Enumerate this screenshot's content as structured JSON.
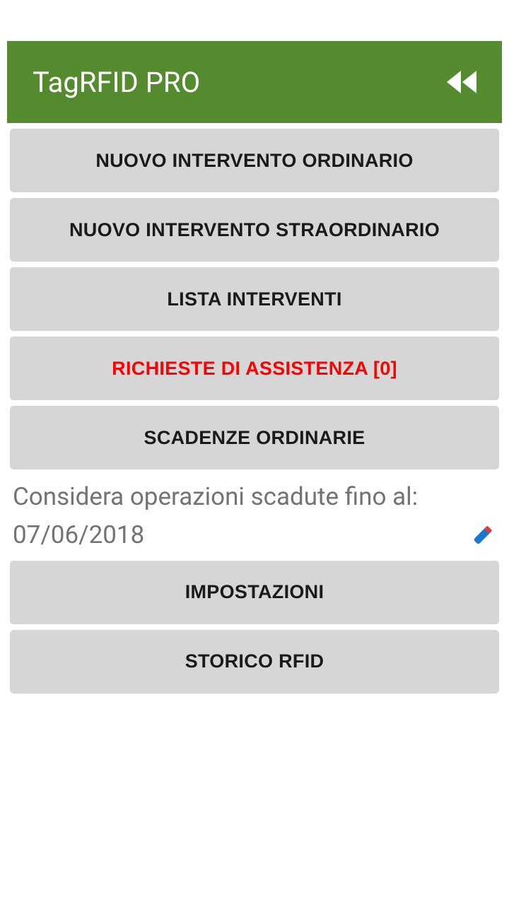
{
  "header": {
    "title": "TagRFID PRO"
  },
  "buttons": {
    "nuovo_ordinario": "NUOVO INTERVENTO ORDINARIO",
    "nuovo_straordinario": "NUOVO INTERVENTO STRAORDINARIO",
    "lista_interventi": "LISTA INTERVENTI",
    "richieste_assistenza": "RICHIESTE DI ASSISTENZA [0]",
    "scadenze_ordinarie": "SCADENZE ORDINARIE",
    "impostazioni": "IMPOSTAZIONI",
    "storico_rfid": "STORICO RFID"
  },
  "info": {
    "label": "Considera operazioni scadute fino al:",
    "date": "07/06/2018"
  }
}
